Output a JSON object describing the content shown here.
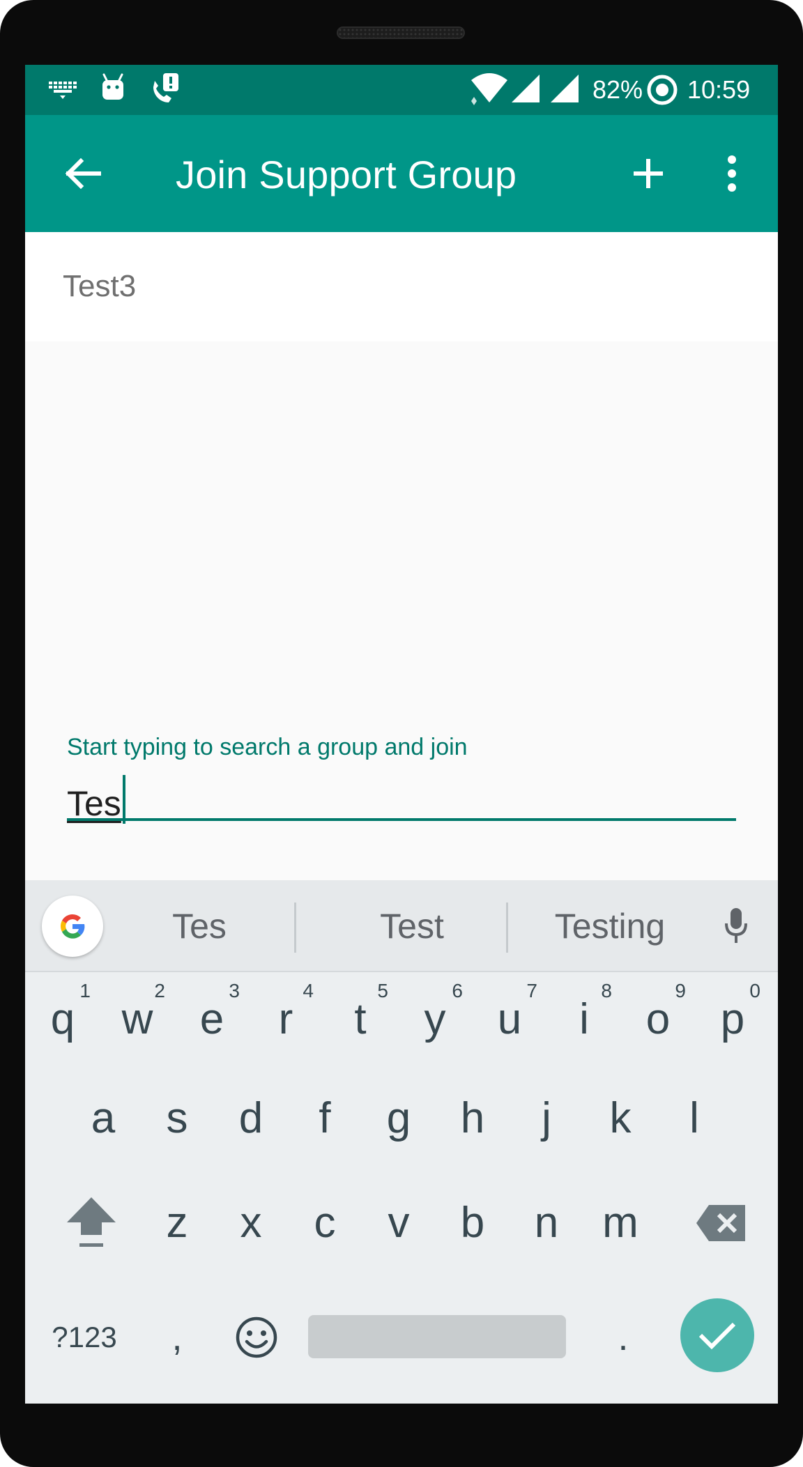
{
  "status_bar": {
    "battery_percent": "82%",
    "time": "10:59",
    "icons": [
      "keyboard-icon",
      "android-icon",
      "call-alert-icon",
      "wifi-icon",
      "signal-icon",
      "signal-icon",
      "battery-ring-icon"
    ]
  },
  "app_bar": {
    "title": "Join Support Group",
    "icons": [
      "back-arrow-icon",
      "add-icon",
      "overflow-menu-icon"
    ]
  },
  "group_list": {
    "items": [
      {
        "label": "Test3"
      }
    ]
  },
  "search": {
    "hint": "Start typing to search a group and join",
    "value": "Tes"
  },
  "keyboard": {
    "suggestions": [
      "Tes",
      "Test",
      "Testing"
    ],
    "row1": [
      {
        "key": "q",
        "hint": "1"
      },
      {
        "key": "w",
        "hint": "2"
      },
      {
        "key": "e",
        "hint": "3"
      },
      {
        "key": "r",
        "hint": "4"
      },
      {
        "key": "t",
        "hint": "5"
      },
      {
        "key": "y",
        "hint": "6"
      },
      {
        "key": "u",
        "hint": "7"
      },
      {
        "key": "i",
        "hint": "8"
      },
      {
        "key": "o",
        "hint": "9"
      },
      {
        "key": "p",
        "hint": "0"
      }
    ],
    "row2": [
      "a",
      "s",
      "d",
      "f",
      "g",
      "h",
      "j",
      "k",
      "l"
    ],
    "row3": [
      "z",
      "x",
      "c",
      "v",
      "b",
      "n",
      "m"
    ],
    "symbols_label": "?123",
    "comma": ",",
    "period": ".",
    "accent_color": "#4db6ac"
  },
  "colors": {
    "status_bar": "#00796b",
    "app_bar": "#009688",
    "accent": "#00796b"
  }
}
